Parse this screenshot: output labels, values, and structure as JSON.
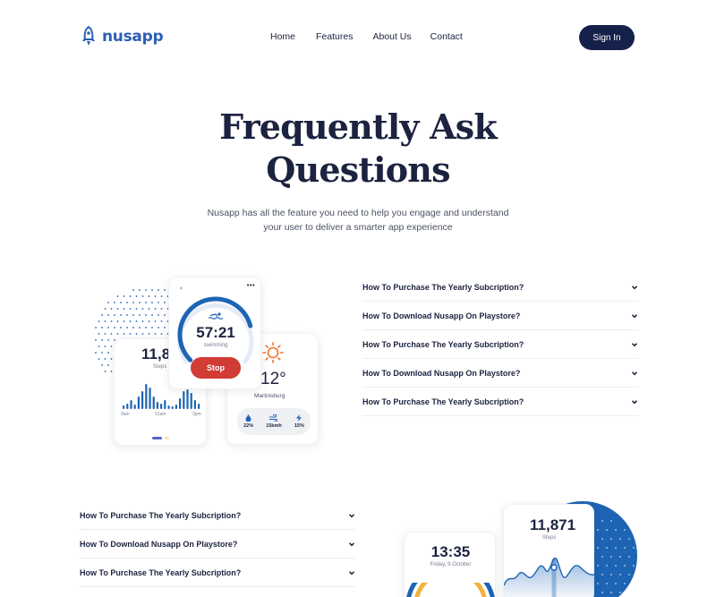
{
  "nav": {
    "logo_text": "nusapp",
    "links": [
      "Home",
      "Features",
      "About Us",
      "Contact"
    ],
    "signin_label": "Sign In"
  },
  "hero": {
    "title_line1": "Frequently Ask",
    "title_line2": "Questions",
    "subtitle_line1": "Nusapp has all the feature you need to help you engage and understand",
    "subtitle_line2": "your user to deliver a smarter app experience"
  },
  "faq_top": [
    "How To Purchase The Yearly Subcription?",
    "How To Download Nusapp On Playstore?",
    "How To Purchase The Yearly Subcription?",
    "How To Download Nusapp On Playstore?",
    "How To Purchase The Yearly Subcription?"
  ],
  "faq_bottom": [
    "How To Purchase The Yearly Subcription?",
    "How To Download Nusapp On Playstore?",
    "How To Purchase The Yearly Subcription?"
  ],
  "mockup_steps": {
    "value": "11,87",
    "label": "Steps",
    "axis": [
      "9am",
      "12am",
      "3pm"
    ]
  },
  "mockup_swim": {
    "time": "57:21",
    "activity": "swimming",
    "stop_label": "Stop",
    "progress": 0.78
  },
  "mockup_weather": {
    "temp": "12°",
    "city": "Martinsburg",
    "humidity": "22%",
    "wind": "15kmh",
    "rain": "15%"
  },
  "mockup_time": {
    "time": "13:35",
    "date": "Friday, 9 October"
  },
  "mockup_steps2": {
    "value": "11,871",
    "label": "Steps"
  },
  "colors": {
    "primary_dark": "#15214a",
    "brand_blue": "#2d5fb3",
    "accent_blue": "#1e64b4",
    "stop_red": "#d13c34",
    "sun_orange": "#f0752c"
  }
}
